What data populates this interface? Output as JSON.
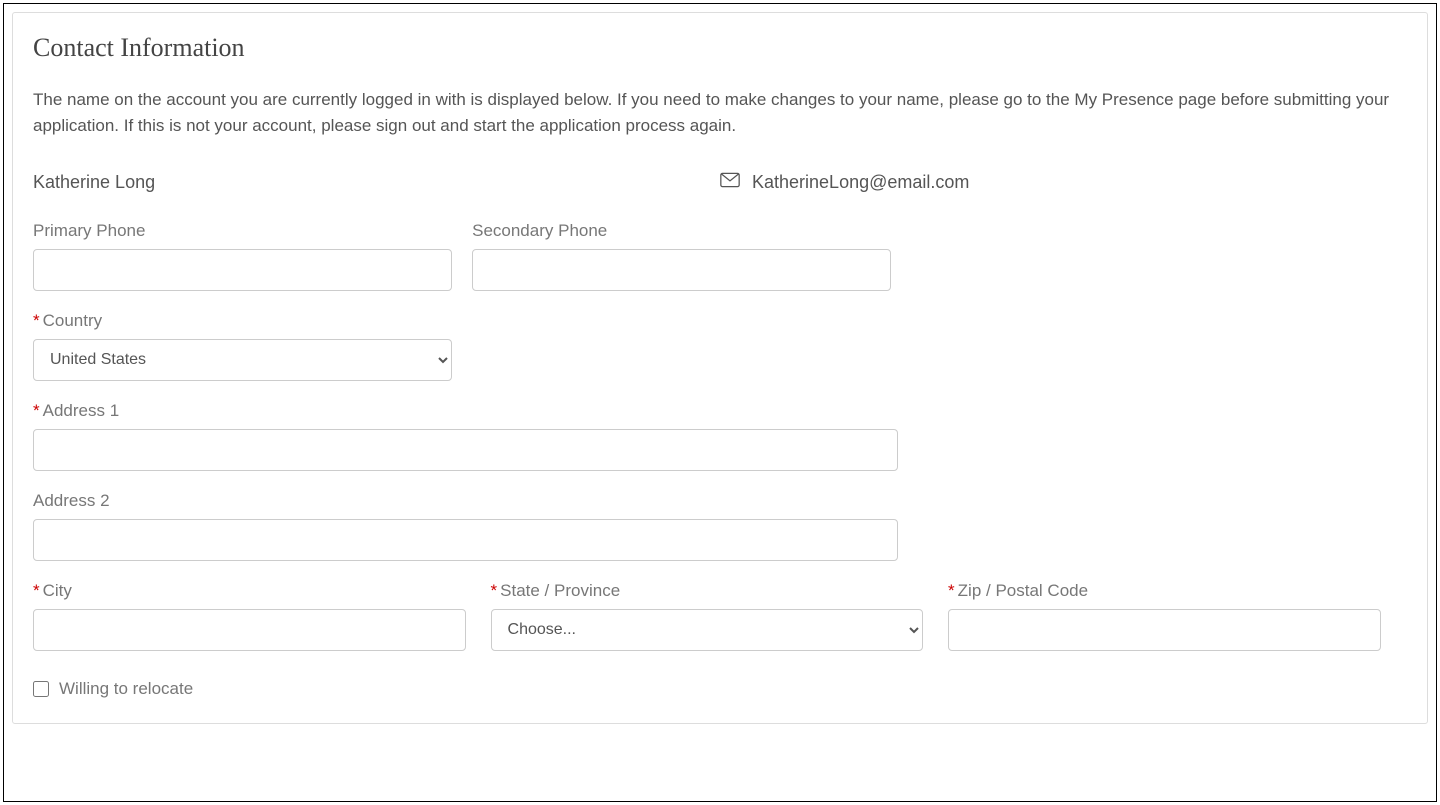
{
  "section": {
    "title": "Contact Information",
    "description": "The name on the account you are currently logged in with is displayed below. If you need to make changes to your name, please go to the My Presence page before submitting your application. If this is not your account, please sign out and start the application process again."
  },
  "identity": {
    "name": "Katherine Long",
    "email": "KatherineLong@email.com"
  },
  "fields": {
    "primary_phone": {
      "label": "Primary Phone",
      "value": ""
    },
    "secondary_phone": {
      "label": "Secondary Phone",
      "value": ""
    },
    "country": {
      "label": "Country",
      "selected": "United States"
    },
    "address1": {
      "label": "Address 1",
      "value": ""
    },
    "address2": {
      "label": "Address 2",
      "value": ""
    },
    "city": {
      "label": "City",
      "value": ""
    },
    "state": {
      "label": "State / Province",
      "selected": "Choose..."
    },
    "zip": {
      "label": "Zip / Postal Code",
      "value": ""
    },
    "relocate": {
      "label": "Willing to relocate",
      "checked": false
    }
  },
  "required_marker": "*"
}
